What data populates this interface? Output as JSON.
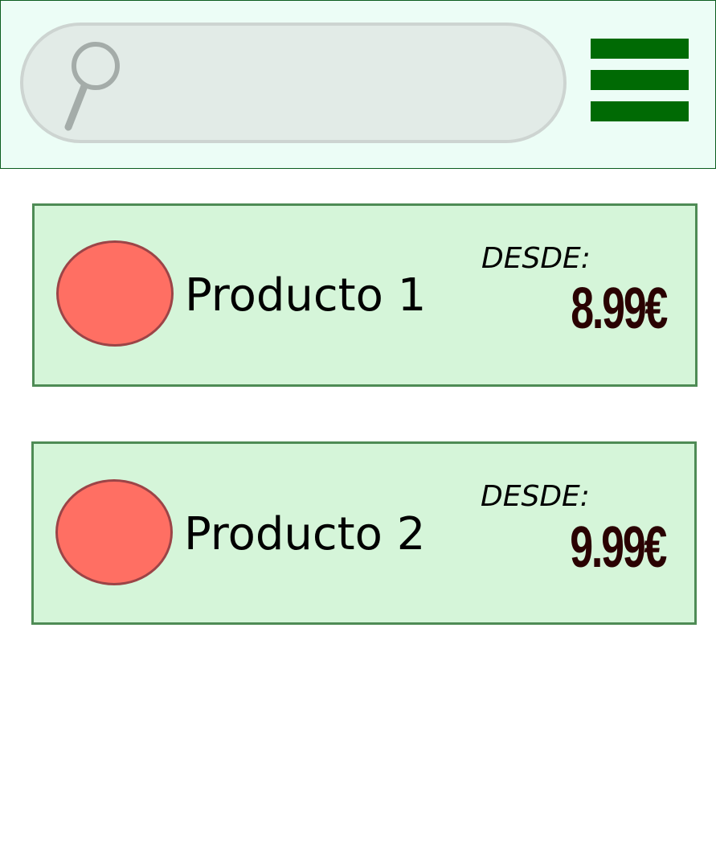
{
  "search": {
    "placeholder": "",
    "icon": "search-icon"
  },
  "menu": {
    "icon": "hamburger-menu-icon"
  },
  "colors": {
    "header_bg": "#ecfdf6",
    "header_border": "#0b5d1e",
    "menu_bars": "#006a04",
    "card_bg": "#d5f5d9",
    "card_border": "#4e8b55",
    "product_image": "#ff6f63",
    "price_text": "#2a0202"
  },
  "products": [
    {
      "name": "Producto 1",
      "price_label": "DESDE:",
      "price": "8.99€",
      "image": "product-image-placeholder"
    },
    {
      "name": "Producto 2",
      "price_label": "DESDE:",
      "price": "9.99€",
      "image": "product-image-placeholder"
    }
  ]
}
